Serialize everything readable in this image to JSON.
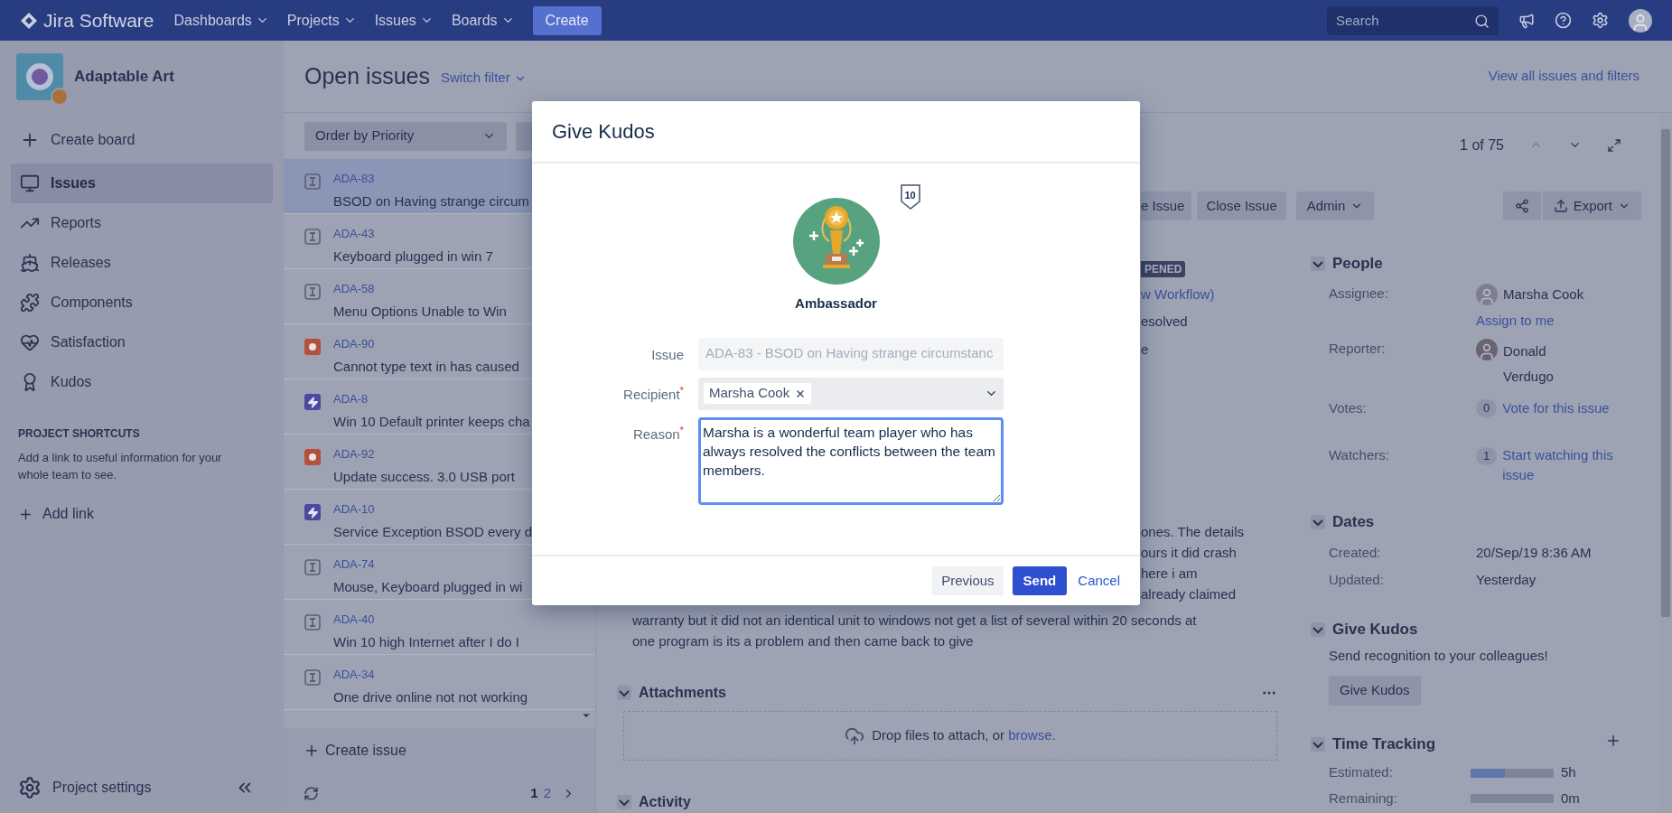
{
  "nav": {
    "logo": "Jira Software",
    "menus": [
      "Dashboards",
      "Projects",
      "Issues",
      "Boards"
    ],
    "create": "Create",
    "search": {
      "placeholder": "Search"
    }
  },
  "sidebar": {
    "project": "Adaptable Art",
    "items": [
      {
        "label": "Create board",
        "kind": "action",
        "selected": false
      },
      {
        "label": "Issues",
        "kind": "nav",
        "selected": true
      },
      {
        "label": "Reports",
        "kind": "nav",
        "selected": false
      },
      {
        "label": "Releases",
        "kind": "nav",
        "selected": false
      },
      {
        "label": "Components",
        "kind": "nav",
        "selected": false
      },
      {
        "label": "Satisfaction",
        "kind": "nav",
        "selected": false
      },
      {
        "label": "Kudos",
        "kind": "nav",
        "selected": false
      }
    ],
    "shortcuts_heading": "PROJECT SHORTCUTS",
    "shortcuts_text": "Add a link to useful information for your whole team to see.",
    "add_link": "Add link",
    "settings": "Project settings"
  },
  "header": {
    "title": "Open issues",
    "switch_filter": "Switch filter",
    "view_all": "View all issues and filters"
  },
  "issue_list": {
    "order": "Order by Priority",
    "issues": [
      {
        "key": "ADA-83",
        "summary": "BSOD on Having strange circum",
        "kind": "task",
        "selected": true
      },
      {
        "key": "ADA-43",
        "summary": "Keyboard plugged in win 7",
        "kind": "task",
        "selected": false
      },
      {
        "key": "ADA-58",
        "summary": "Menu Options Unable to Win",
        "kind": "task",
        "selected": false
      },
      {
        "key": "ADA-90",
        "summary": "Cannot type text in has caused",
        "kind": "bug",
        "selected": false
      },
      {
        "key": "ADA-8",
        "summary": "Win 10 Default printer keeps cha",
        "kind": "improvement",
        "selected": false
      },
      {
        "key": "ADA-92",
        "summary": "Update success. 3.0 USB port",
        "kind": "bug",
        "selected": false
      },
      {
        "key": "ADA-10",
        "summary": "Service Exception BSOD every d",
        "kind": "improvement",
        "selected": false
      },
      {
        "key": "ADA-74",
        "summary": "Mouse, Keyboard plugged in wi",
        "kind": "task",
        "selected": false
      },
      {
        "key": "ADA-40",
        "summary": "Win 10 high Internet after I do I",
        "kind": "task",
        "selected": false
      },
      {
        "key": "ADA-34",
        "summary": "One drive online not not working",
        "kind": "task",
        "selected": false
      }
    ],
    "create_issue": "Create issue",
    "pages": [
      {
        "label": "1",
        "selected": true
      },
      {
        "label": "2",
        "selected": false
      }
    ]
  },
  "detail": {
    "counter": "1 of 75",
    "partial_button": "e Issue",
    "close_button": "Close Issue",
    "admin": "Admin",
    "export": "Export",
    "status": "PENED",
    "workflow": "w Workflow)",
    "resolution": "esolved",
    "fragment": "e",
    "description_ends": [
      "ones. The details",
      "ours it did crash",
      "here i am",
      "already claimed"
    ],
    "description_lines": [
      "warranty but it did not an identical unit to windows not get a list of several within 20 seconds at",
      "one program is its a problem and then came back to give"
    ],
    "attachments": {
      "title": "Attachments",
      "drop_text": "Drop files to attach, or ",
      "browse": "browse."
    },
    "activity": "Activity",
    "people": {
      "title": "People",
      "assignee_label": "Assignee:",
      "assignee": "Marsha Cook",
      "assign_to_me": "Assign to me",
      "reporter_label": "Reporter:",
      "reporter": "Donald Verdugo",
      "votes_label": "Votes:",
      "votes": "0",
      "vote_link": "Vote for this issue",
      "watchers_label": "Watchers:",
      "watchers": "1",
      "watch_link": "Start watching this issue"
    },
    "dates": {
      "title": "Dates",
      "rows": [
        {
          "label": "Created:",
          "value": "20/Sep/19 8:36 AM"
        },
        {
          "label": "Updated:",
          "value": "Yesterday"
        }
      ]
    },
    "kudos": {
      "title": "Give Kudos",
      "text": "Send recognition to your colleagues!",
      "button": "Give Kudos"
    },
    "time_tracking": {
      "title": "Time Tracking",
      "rows": [
        {
          "label": "Estimated:",
          "level": 0.41,
          "value": "5h"
        },
        {
          "label": "Remaining:",
          "value": "0m"
        }
      ]
    }
  },
  "modal": {
    "title": "Give Kudos",
    "badge_name": "Ambassador",
    "badge_count": "10",
    "required_mark": "*",
    "fields": [
      {
        "label": "Issue",
        "kind": "readonly",
        "required": false,
        "value": "ADA-83 - BSOD on Having strange circumstanc"
      },
      {
        "label": "Recipient",
        "kind": "select",
        "required": true,
        "tags": [
          "Marsha Cook"
        ]
      },
      {
        "label": "Reason",
        "kind": "textarea",
        "required": true,
        "value": "Marsha is a wonderful team player who has always resolved the conflicts between the team members."
      }
    ],
    "buttons": [
      {
        "label": "Previous",
        "kind": "secondary"
      },
      {
        "label": "Send",
        "kind": "primary"
      },
      {
        "label": "Cancel",
        "kind": "link"
      }
    ]
  }
}
